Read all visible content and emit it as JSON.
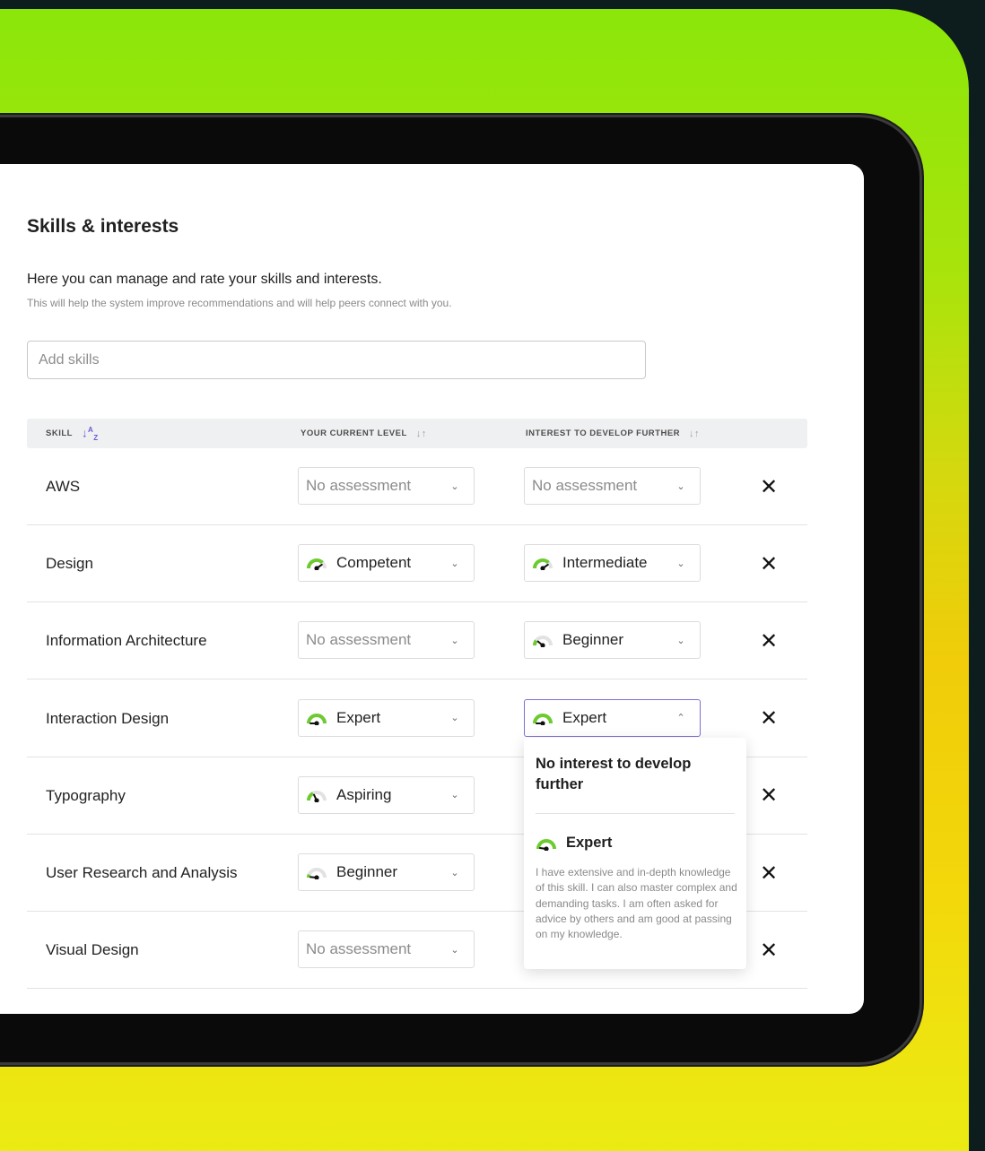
{
  "page": {
    "title": "Skills & interests",
    "intro": "Here you can manage and rate your skills and interests.",
    "intro_sub": "This will help the system improve recommendations and will help peers connect with you."
  },
  "add_skills": {
    "placeholder": "Add skills"
  },
  "table": {
    "headers": {
      "skill": "SKILL",
      "current_level": "YOUR CURRENT LEVEL",
      "interest": "INTEREST TO DEVELOP FURTHER"
    },
    "rows": [
      {
        "skill": "AWS",
        "current": "No assessment",
        "current_gauge": "none",
        "interest": "No assessment",
        "interest_gauge": "none",
        "remove": "✕"
      },
      {
        "skill": "Design",
        "current": "Competent",
        "current_gauge": "competent",
        "interest": "Intermediate",
        "interest_gauge": "competent",
        "remove": "✕"
      },
      {
        "skill": "Information Architecture",
        "current": "No assessment",
        "current_gauge": "none",
        "interest": "Beginner",
        "interest_gauge": "beginner-low",
        "remove": "✕"
      },
      {
        "skill": "Interaction Design",
        "current": "Expert",
        "current_gauge": "expert",
        "interest": "Expert",
        "interest_gauge": "expert",
        "remove": "✕"
      },
      {
        "skill": "Typography",
        "current": "Aspiring",
        "current_gauge": "aspiring",
        "remove": "✕"
      },
      {
        "skill": "User Research and Analysis",
        "current": "Beginner",
        "current_gauge": "beginner",
        "remove": "✕"
      },
      {
        "skill": "Visual Design",
        "current": "No assessment",
        "current_gauge": "none",
        "remove": "✕"
      }
    ]
  },
  "dropdown": {
    "no_interest": "No interest to develop further",
    "option": "Expert",
    "option_description": "I have extensive and in-depth knowledge of this skill. I can also master complex and demanding tasks. I am often asked for advice by others and am good at passing on my knowledge."
  },
  "colors": {
    "gauge_active": "#6ccb2e",
    "gauge_track": "#e2e2e2",
    "sort_active": "#6a5ad6",
    "open_border": "#7b6fd6"
  }
}
